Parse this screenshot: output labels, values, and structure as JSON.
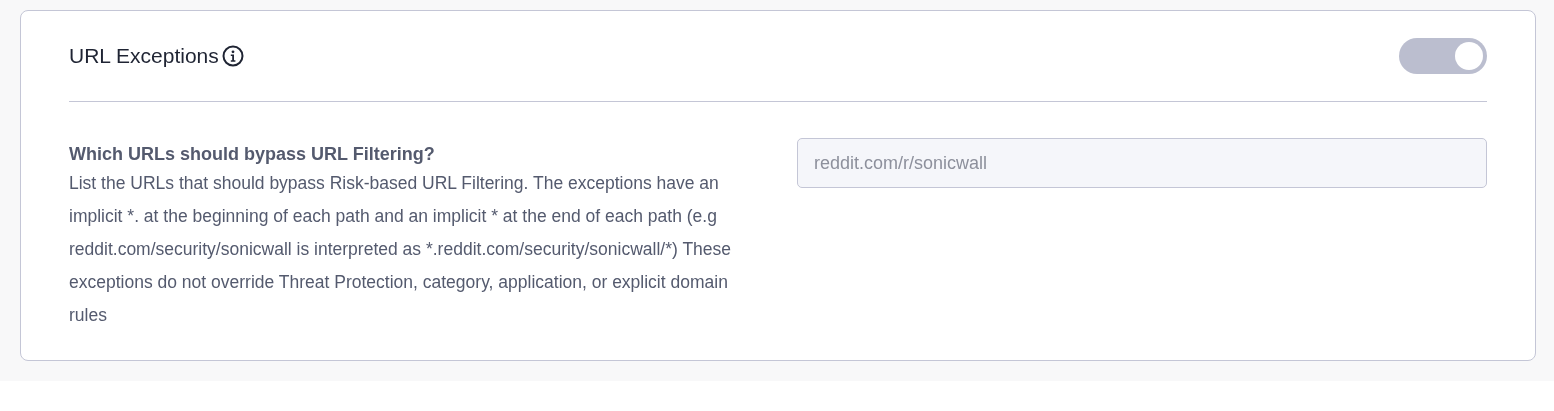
{
  "section": {
    "title": "URL Exceptions",
    "toggle": {
      "on": true
    }
  },
  "question": "Which URLs should bypass URL Filtering?",
  "description": "List the URLs that should bypass Risk-based URL Filtering. The exceptions have an implicit *. at the beginning of each path and an implicit * at the end of each path (e.g reddit.com/security/sonicwall is interpreted as *.reddit.com/security/sonicwall/*) These exceptions do not override Threat Protection, category, application, or explicit domain rules",
  "url_field": {
    "placeholder": "reddit.com/r/sonicwall"
  }
}
